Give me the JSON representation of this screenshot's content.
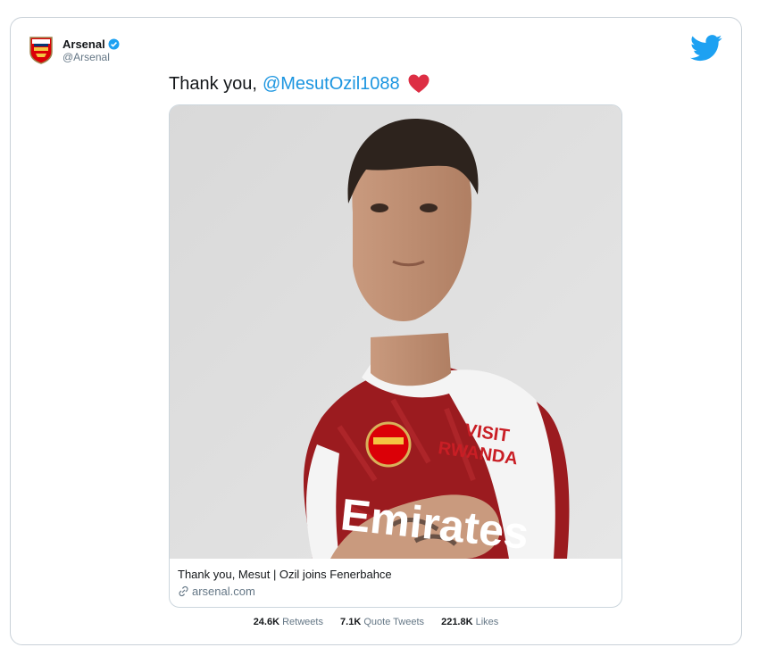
{
  "account": {
    "name": "Arsenal",
    "handle": "@Arsenal",
    "verified": true
  },
  "tweet": {
    "text": "Thank you,",
    "mention": "@MesutOzil1088",
    "emoji": "red-heart"
  },
  "link_card": {
    "title": "Thank you, Mesut | Ozil joins Fenerbahce",
    "domain": "arsenal.com",
    "image_shirt_text": {
      "sleeve_line1": "VISIT",
      "sleeve_line2": "RWANDA",
      "chest": "Emirates"
    }
  },
  "stats": {
    "retweets_count": "24.6K",
    "retweets_label": "Retweets",
    "quotes_count": "7.1K",
    "quotes_label": "Quote Tweets",
    "likes_count": "221.8K",
    "likes_label": "Likes"
  },
  "colors": {
    "twitter_blue": "#1da1f2",
    "mention_blue": "#1b95e0",
    "arsenal_red": "#9b1b1f",
    "heart_red": "#dd2e44"
  }
}
